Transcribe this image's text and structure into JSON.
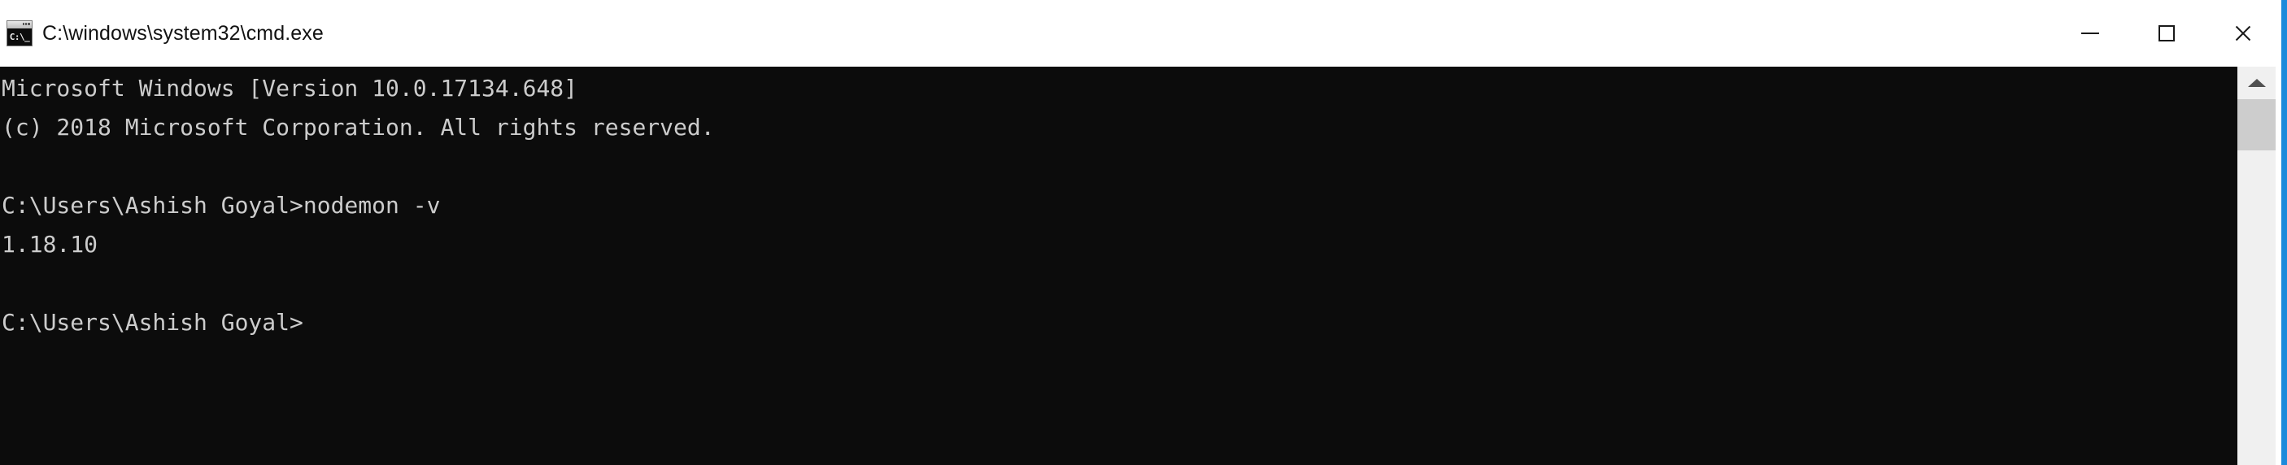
{
  "window": {
    "title": "C:\\windows\\system32\\cmd.exe",
    "icon_name": "cmd-exe-icon",
    "icon_glyph": "C:\\_",
    "colors": {
      "titlebar_bg": "#ffffff",
      "titlebar_text": "#121212",
      "console_bg": "#0c0c0c",
      "console_text": "#cccccc",
      "focus_border": "#1c8adb",
      "scrollbar_track": "#f0f0f0",
      "scrollbar_thumb": "#cdcdcd"
    }
  },
  "controls": {
    "minimize_label": "−",
    "minimize_tooltip": "Minimize",
    "maximize_label": "□",
    "maximize_tooltip": "Maximize",
    "close_label": "✕",
    "close_tooltip": "Close"
  },
  "console": {
    "lines": [
      "Microsoft Windows [Version 10.0.17134.648]",
      "(c) 2018 Microsoft Corporation. All rights reserved.",
      "",
      "C:\\Users\\Ashish Goyal>nodemon -v",
      "1.18.10",
      "",
      "C:\\Users\\Ashish Goyal>"
    ],
    "os_name": "Microsoft Windows",
    "os_version": "10.0.17134.648",
    "copyright": "(c) 2018 Microsoft Corporation. All rights reserved.",
    "prompt": "C:\\Users\\Ashish Goyal>",
    "command": "nodemon -v",
    "command_output": "1.18.10"
  },
  "scrollbar": {
    "up_arrow_name": "scroll-up-arrow",
    "orientation": "vertical"
  }
}
